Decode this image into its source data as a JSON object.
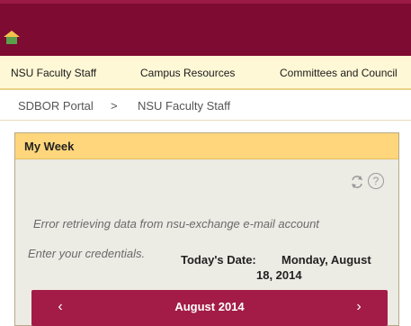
{
  "nav": {
    "items": [
      "NSU Faculty Staff",
      "Campus Resources",
      "Committees and Council"
    ]
  },
  "breadcrumb": {
    "root": "SDBOR Portal",
    "separator": ">",
    "current": "NSU Faculty Staff"
  },
  "panel": {
    "title": "My Week",
    "error": "Error retrieving data from nsu-exchange e-mail account",
    "credentials": "Enter your credentials.",
    "today_label": "Today's Date:",
    "today_value_line1": "Monday, August",
    "today_value_line2": "18, 2014",
    "calendar": {
      "month": "August 2014",
      "prev": "‹",
      "next": "›"
    }
  },
  "colors": {
    "topbar": "#7d0b32",
    "navbar": "#fff8d6",
    "panel_header": "#ffd67b",
    "calendar_bar": "#a31c47"
  },
  "icons": {
    "home": "home-icon",
    "refresh": "refresh-icon",
    "help": "help-icon"
  }
}
